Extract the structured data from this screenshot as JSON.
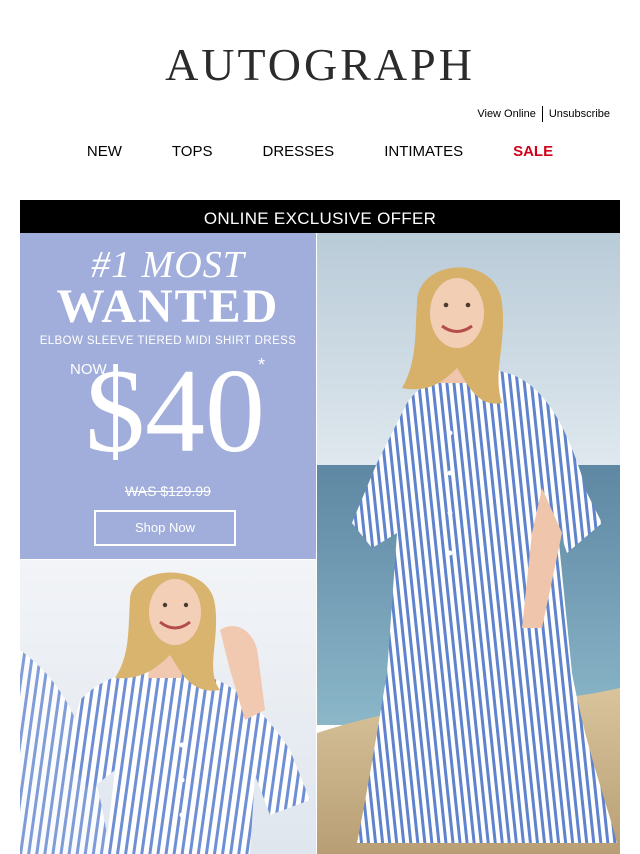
{
  "brand": {
    "logo_text": "AUTOGRAPH"
  },
  "utility": {
    "view_online": "View Online",
    "unsubscribe": "Unsubscribe"
  },
  "nav": {
    "items": [
      {
        "label": "NEW"
      },
      {
        "label": "TOPS"
      },
      {
        "label": "DRESSES"
      },
      {
        "label": "INTIMATES"
      },
      {
        "label": "SALE"
      }
    ]
  },
  "banner": {
    "text": "ONLINE EXCLUSIVE OFFER"
  },
  "promo": {
    "headline_top": "#1 MOST",
    "headline_main": "WANTED",
    "subtitle": "ELBOW SLEEVE TIERED MIDI SHIRT DRESS",
    "now_label": "NOW",
    "price": "$40",
    "asterisk": "*",
    "was_price": "WAS $129.99",
    "cta_label": "Shop Now"
  },
  "colors": {
    "promo_panel": "#a1aedb",
    "sale": "#d0021b",
    "banner_bg": "#000000"
  }
}
